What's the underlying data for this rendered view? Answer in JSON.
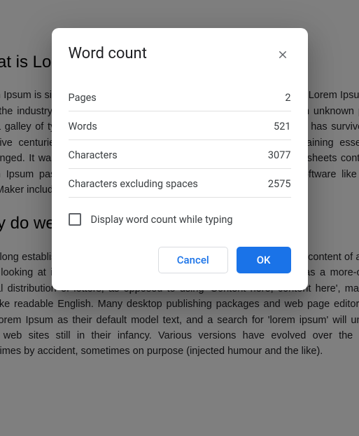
{
  "document": {
    "heading1": "What is Lorem?",
    "para1": "Lorem Ipsum is simply dummy text of the printing and typesetting industry. Lorem Ipsum has been the industry's standard dummy text ever since the 1500s, when an unknown printer took a galley of type and scrambled it to make a type specimen book. It has survived not only five centuries, but also the leap into electronic typesetting, remaining essentially unchanged. It was popularised in the 1960s with the release of Letraset sheets containing Lorem Ipsum passages, and more recently with desktop publishing software like Aldus PageMaker including versions of Lorem Ipsum.",
    "heading2": "Why do we use it?",
    "para2": "It is a long established fact that a reader will be distracted by the readable content of a page when looking at its layout. The point of using Lorem Ipsum is that it has a more-or-less normal distribution of letters, as opposed to using 'Content here, content here', making it look like readable English. Many desktop publishing packages and web page editors now use Lorem Ipsum as their default model text, and a search for 'lorem ipsum' will uncover many web sites still in their infancy. Various versions have evolved over the years, sometimes by accident, sometimes on purpose (injected humour and the like)."
  },
  "dialog": {
    "title": "Word count",
    "stats": {
      "pages_label": "Pages",
      "pages_value": "2",
      "words_label": "Words",
      "words_value": "521",
      "chars_label": "Characters",
      "chars_value": "3077",
      "chars_ns_label": "Characters excluding spaces",
      "chars_ns_value": "2575"
    },
    "checkbox_label": "Display word count while typing",
    "cancel_label": "Cancel",
    "ok_label": "OK"
  }
}
